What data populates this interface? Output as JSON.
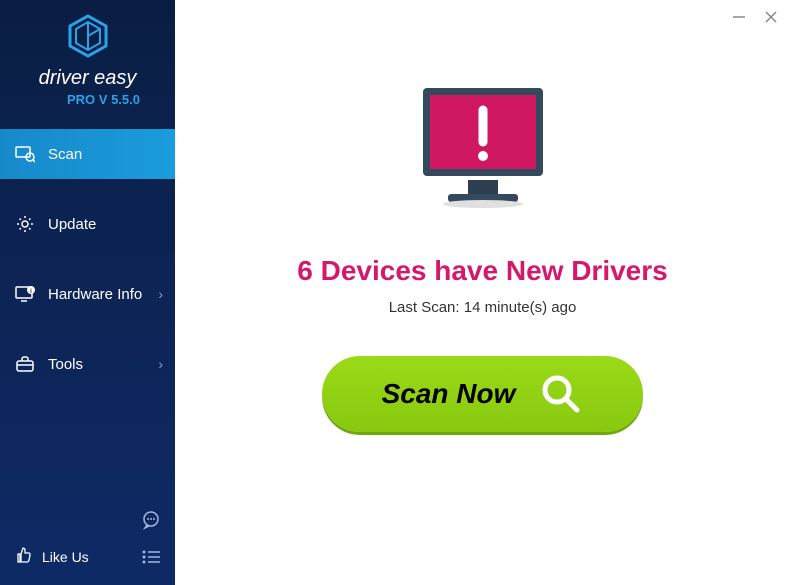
{
  "app": {
    "name": "driver easy",
    "version": "PRO V 5.5.0"
  },
  "sidebar": {
    "items": [
      {
        "label": "Scan",
        "active": true,
        "hasChevron": false
      },
      {
        "label": "Update",
        "active": false,
        "hasChevron": false
      },
      {
        "label": "Hardware Info",
        "active": false,
        "hasChevron": true
      },
      {
        "label": "Tools",
        "active": false,
        "hasChevron": true
      }
    ],
    "likeUs": "Like Us"
  },
  "main": {
    "headline": "6 Devices have New Drivers",
    "lastScan": "Last Scan: 14 minute(s) ago",
    "scanButton": "Scan Now"
  }
}
